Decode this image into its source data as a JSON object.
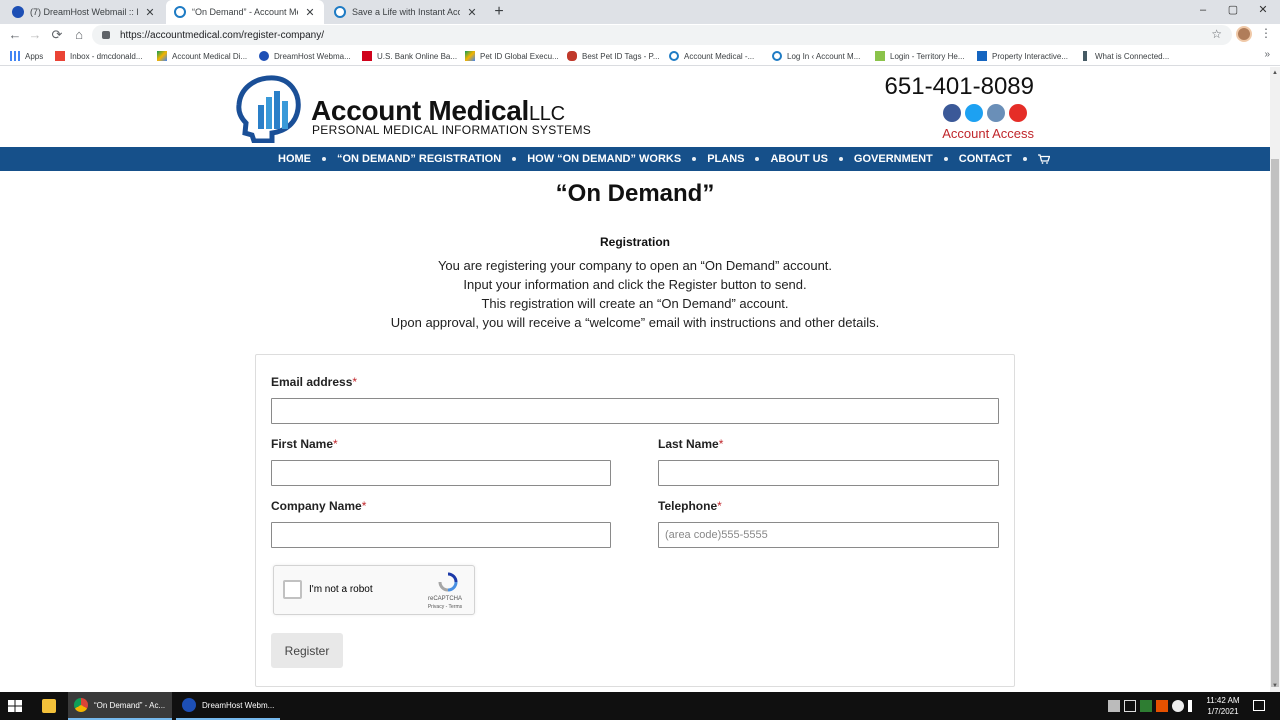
{
  "browser": {
    "tabs": [
      {
        "title": "(7) DreamHost Webmail :: Inbox",
        "close": "✕"
      },
      {
        "title": "“On Demand” - Account Medical",
        "close": "✕"
      },
      {
        "title": "Save a Life with Instant Access to",
        "close": "✕"
      }
    ],
    "new_tab": "+",
    "window_controls": {
      "minimize": "–",
      "maximize": "▢",
      "close": "✕"
    },
    "url": "https://accountmedical.com/register-company/",
    "nav": {
      "back": "←",
      "forward": "→",
      "reload": "⟳",
      "home": "⌂",
      "star": "☆",
      "menu": "⋮"
    },
    "bookmarks": [
      "Apps",
      "Inbox - dmcdonald...",
      "Account Medical Di...",
      "DreamHost Webma...",
      "U.S. Bank Online Ba...",
      "Pet ID Global Execu...",
      "Best Pet ID Tags - P...",
      "Account Medical -...",
      "Log In ‹ Account M...",
      "Login - Territory He...",
      "Property Interactive...",
      "What is Connected..."
    ],
    "bookmarks_more": "»"
  },
  "site": {
    "logo_name": "Account Medical",
    "logo_llc": "LLC",
    "logo_tagline": "PERSONAL MEDICAL INFORMATION SYSTEMS",
    "phone": "651-401-8089",
    "account_access": "Account Access",
    "nav": [
      "HOME",
      "“ON DEMAND” REGISTRATION",
      "HOW “ON DEMAND” WORKS",
      "PLANS",
      "ABOUT US",
      "GOVERNMENT",
      "CONTACT"
    ],
    "colors": {
      "nav_bg": "#16508a",
      "accent_red": "#c0262b"
    }
  },
  "page": {
    "heading": "“On Demand”",
    "registration_title": "Registration",
    "intro": [
      "You are registering your company to open an “On Demand” account.",
      "Input your information and click the Register button to send.",
      "This registration will create an “On Demand” account.",
      "Upon approval, you will receive a “welcome” email with instructions and other details."
    ]
  },
  "form": {
    "required_mark": "*",
    "email": {
      "label": "Email address",
      "value": "",
      "placeholder": ""
    },
    "first_name": {
      "label": "First Name",
      "value": "",
      "placeholder": ""
    },
    "last_name": {
      "label": "Last Name",
      "value": "",
      "placeholder": ""
    },
    "company": {
      "label": "Company Name",
      "value": "",
      "placeholder": ""
    },
    "telephone": {
      "label": "Telephone",
      "value": "",
      "placeholder": "(area code)555-5555"
    },
    "captcha": {
      "label": "I'm not a robot",
      "brand": "reCAPTCHA",
      "links": "Privacy - Terms"
    },
    "register_label": "Register"
  },
  "taskbar": {
    "items": [
      "“On Demand” - Ac...",
      "DreamHost Webm..."
    ],
    "time": "11:42 AM",
    "date": "1/7/2021"
  }
}
